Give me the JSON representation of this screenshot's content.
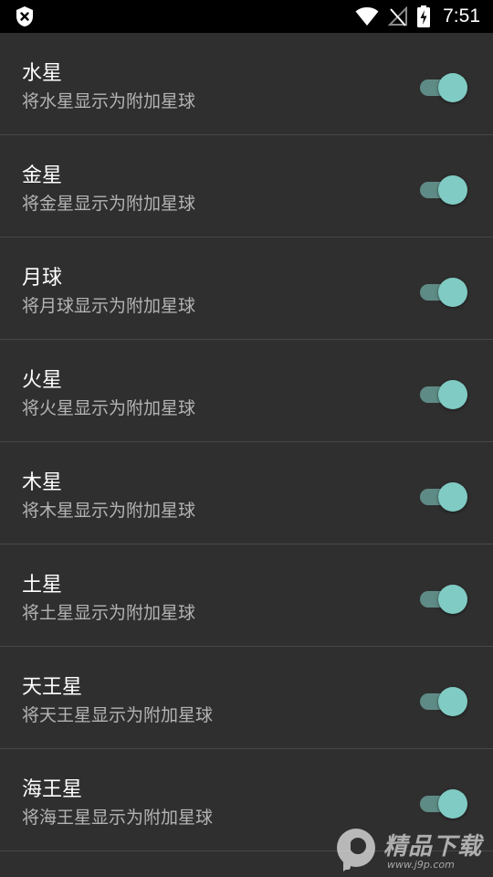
{
  "status_bar": {
    "time": "7:51",
    "left_icon": "shield-x-icon",
    "icons": [
      "wifi-icon",
      "no-signal-icon",
      "battery-charging-icon"
    ]
  },
  "colors": {
    "background": "#2f2f2f",
    "switch_on_thumb": "#80cbc4",
    "switch_on_track": "#5f8b86"
  },
  "settings": [
    {
      "title": "水星",
      "summary": "将水星显示为附加星球",
      "checked": true
    },
    {
      "title": "金星",
      "summary": "将金星显示为附加星球",
      "checked": true
    },
    {
      "title": "月球",
      "summary": "将月球显示为附加星球",
      "checked": true
    },
    {
      "title": "火星",
      "summary": "将火星显示为附加星球",
      "checked": true
    },
    {
      "title": "木星",
      "summary": "将木星显示为附加星球",
      "checked": true
    },
    {
      "title": "土星",
      "summary": "将土星显示为附加星球",
      "checked": true
    },
    {
      "title": "天王星",
      "summary": "将天王星显示为附加星球",
      "checked": true
    },
    {
      "title": "海王星",
      "summary": "将海王星显示为附加星球",
      "checked": true
    }
  ],
  "watermark": {
    "text": "精品下载",
    "sub": "www.j9p.com"
  }
}
